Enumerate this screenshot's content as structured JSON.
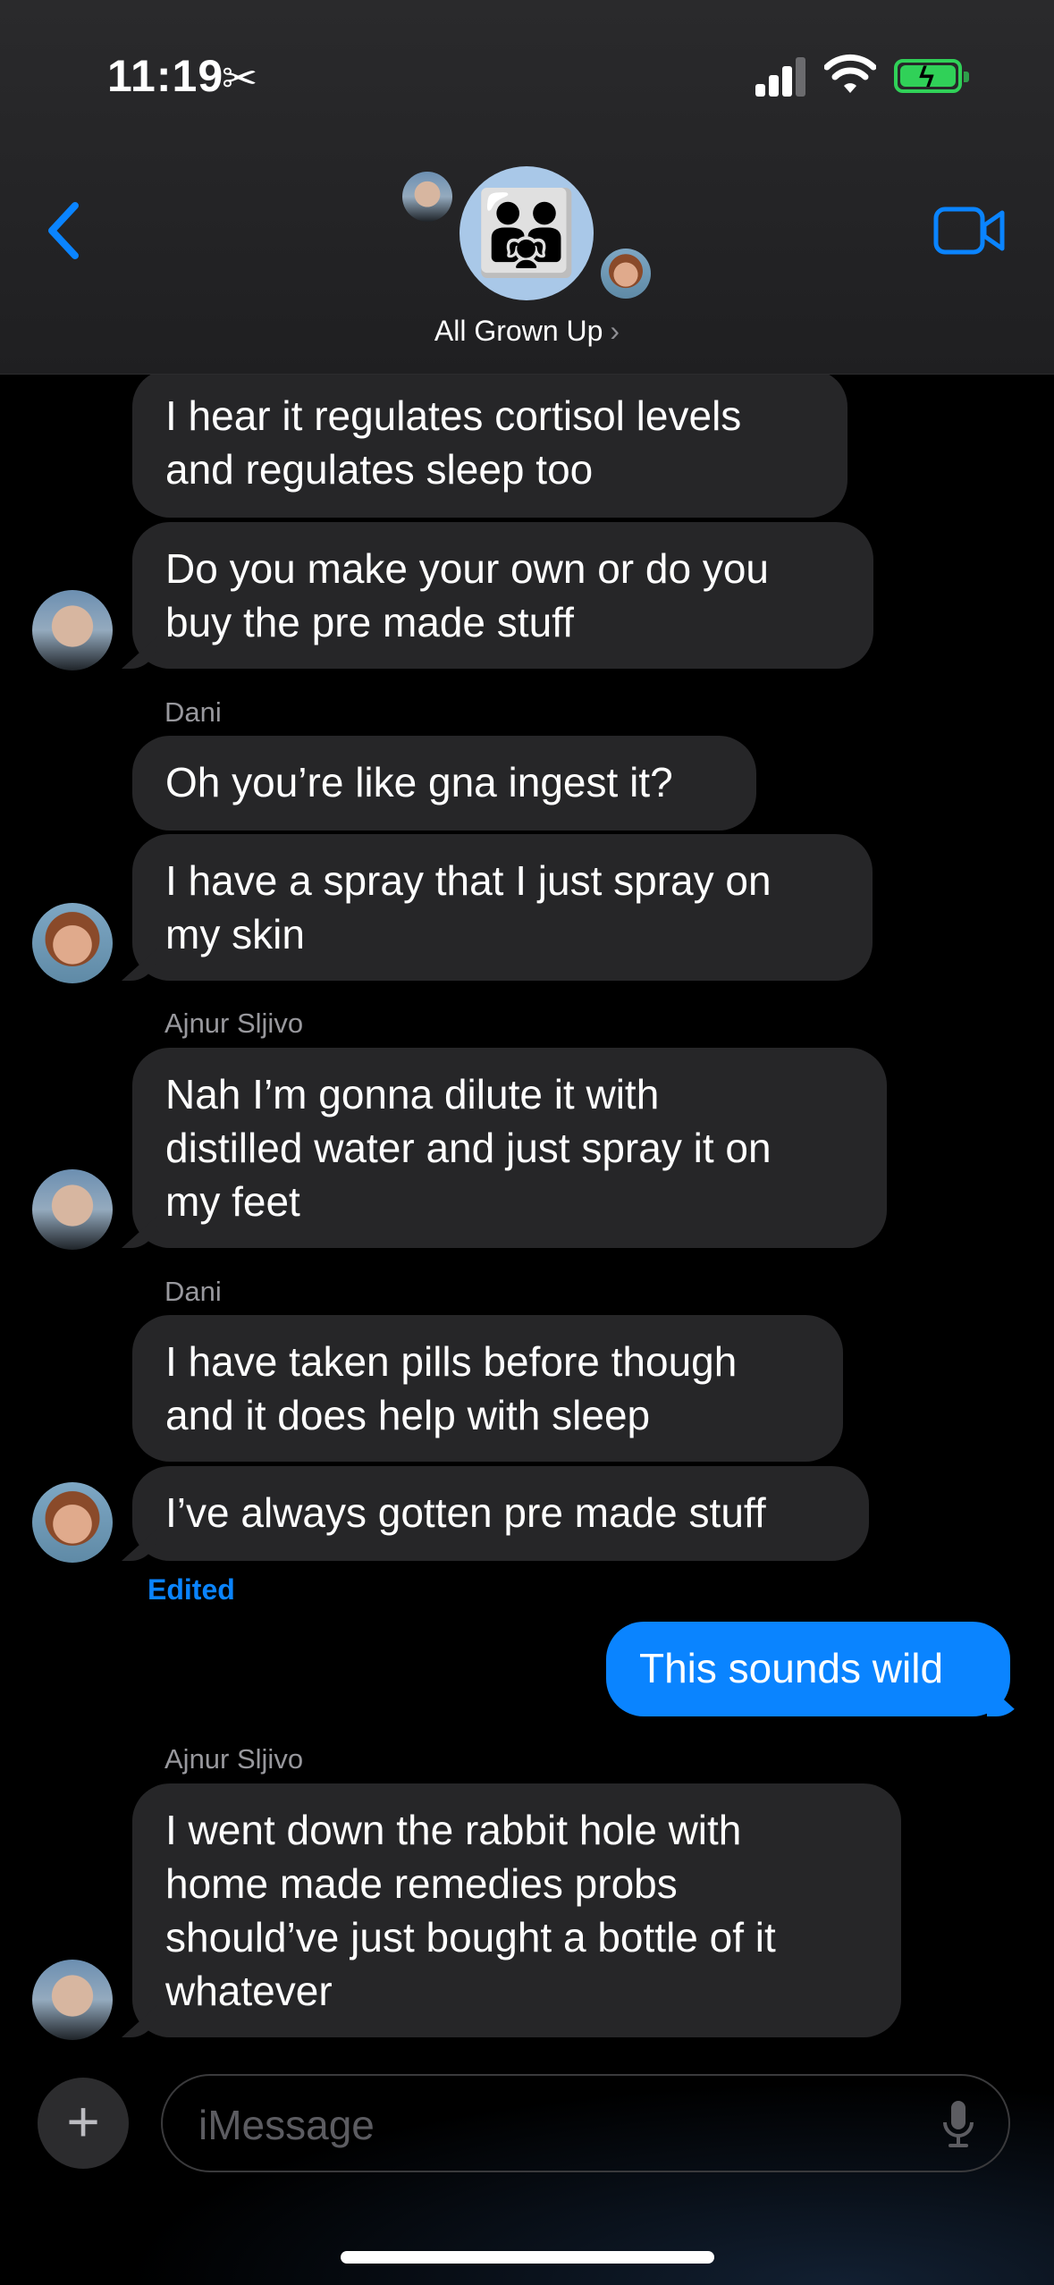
{
  "status_bar": {
    "time": "11:19",
    "mode_icon": "scissors-icon",
    "battery": "charging"
  },
  "header": {
    "group_name": "All Grown Up",
    "group_emoji": "👨‍👨‍👧"
  },
  "messages": [
    {
      "text_lines": [
        "I hear it regulates cortisol levels",
        "and regulates sleep too"
      ]
    },
    {
      "text_lines": [
        "Do you make your own or do you",
        "buy the pre made stuff"
      ]
    },
    {
      "sender": "Dani"
    },
    {
      "text_lines": [
        "Oh you’re like gna ingest it?"
      ]
    },
    {
      "text_lines": [
        "I have a spray that I just spray on",
        "my skin"
      ]
    },
    {
      "sender": "Ajnur Sljivo"
    },
    {
      "text_lines": [
        "Nah I’m gonna dilute it with",
        "distilled water and just spray it on",
        "my feet"
      ]
    },
    {
      "sender": "Dani"
    },
    {
      "text_lines": [
        "I have taken pills before though",
        "and it does help with sleep"
      ]
    },
    {
      "text_lines": [
        "I’ve always gotten pre made stuff"
      ]
    },
    {
      "text_lines": [
        "This sounds wild"
      ]
    },
    {
      "sender": "Ajnur Sljivo"
    },
    {
      "text_lines": [
        "I went down the rabbit hole with",
        "home made remedies probs",
        "should’ve just bought a bottle of it",
        "whatever"
      ]
    }
  ],
  "edited_label": "Edited",
  "composer": {
    "placeholder": "iMessage"
  },
  "colors": {
    "sent_bubble": "#0a84ff",
    "received_bubble": "#262628",
    "accent": "#0a84ff",
    "battery": "#30d158"
  }
}
